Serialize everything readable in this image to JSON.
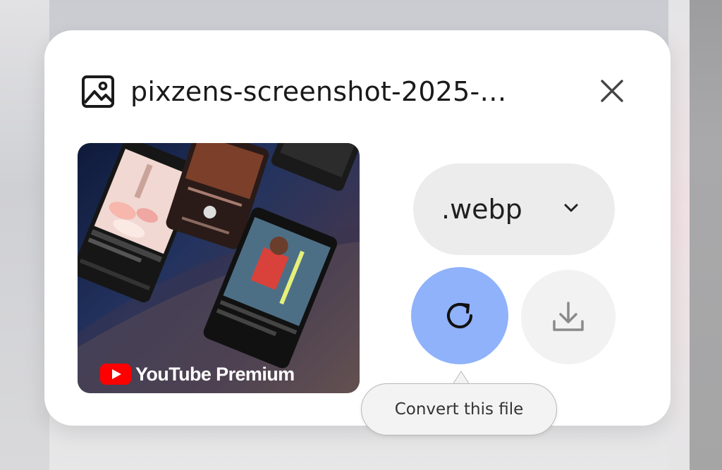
{
  "dialog": {
    "file_name": "pixzens-screenshot-2025-…",
    "icons": {
      "file_type": "image-icon",
      "close": "close-icon"
    }
  },
  "thumbnail": {
    "brand_text": "YouTube Premium",
    "brand_color": "#ff0000"
  },
  "format_select": {
    "selected": ".webp",
    "icon": "chevron-down-icon"
  },
  "actions": {
    "convert_icon": "refresh-icon",
    "download_icon": "download-icon",
    "convert_color": "#8fb2fb"
  },
  "tooltip": {
    "text": "Convert this file"
  }
}
